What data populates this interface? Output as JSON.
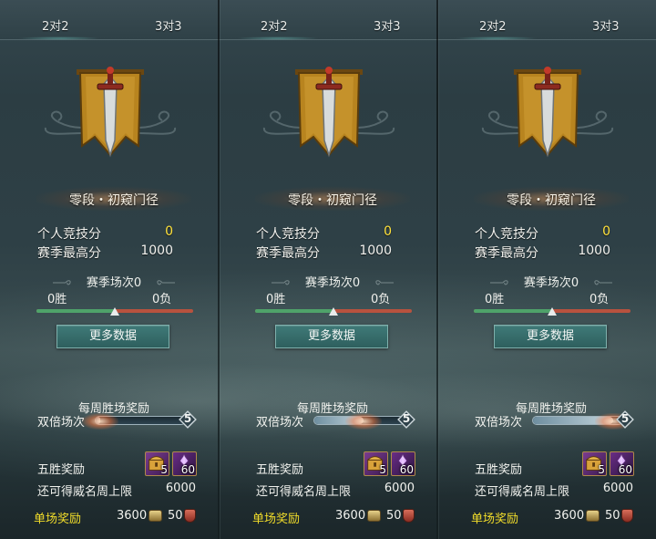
{
  "panels": [
    {
      "tabs": [
        "2对2",
        "3对3"
      ],
      "rank_name": "零段・初窥门径",
      "stats": [
        {
          "label": "个人竞技分",
          "value": "0"
        },
        {
          "label": "赛季最高分",
          "value": "1000"
        }
      ],
      "season_title": "赛季场次0",
      "wins": "0胜",
      "losses": "0负",
      "win_fraction": 0.5,
      "more_button": "更多数据",
      "weekly_title": "每周胜场奖励",
      "double_label": "双倍场次",
      "double_count": "5",
      "double_fraction": 0.05,
      "five_win_label": "五胜奖励",
      "reward_items": [
        {
          "icon": "treasure-chest-icon",
          "qty": "5"
        },
        {
          "icon": "purple-crystal-icon",
          "qty": "60"
        }
      ],
      "limit_label": "还可得威名周上限",
      "limit_value": "6000",
      "single_label": "单场奖励",
      "single_value_1": "3600",
      "single_value_2": "50"
    },
    {
      "tabs": [
        "2对2",
        "3对3"
      ],
      "rank_name": "零段・初窥门径",
      "stats": [
        {
          "label": "个人竞技分",
          "value": "0"
        },
        {
          "label": "赛季最高分",
          "value": "1000"
        }
      ],
      "season_title": "赛季场次0",
      "wins": "0胜",
      "losses": "0负",
      "win_fraction": 0.5,
      "more_button": "更多数据",
      "weekly_title": "每周胜场奖励",
      "double_label": "双倍场次",
      "double_count": "5",
      "double_fraction": 0.55,
      "five_win_label": "五胜奖励",
      "reward_items": [
        {
          "icon": "treasure-chest-icon",
          "qty": "5"
        },
        {
          "icon": "purple-crystal-icon",
          "qty": "60"
        }
      ],
      "limit_label": "还可得威名周上限",
      "limit_value": "6000",
      "single_label": "单场奖励",
      "single_value_1": "3600",
      "single_value_2": "50"
    },
    {
      "tabs": [
        "2对2",
        "3对3"
      ],
      "rank_name": "零段・初窥门径",
      "stats": [
        {
          "label": "个人竞技分",
          "value": "0"
        },
        {
          "label": "赛季最高分",
          "value": "1000"
        }
      ],
      "season_title": "赛季场次0",
      "wins": "0胜",
      "losses": "0负",
      "win_fraction": 0.5,
      "more_button": "更多数据",
      "weekly_title": "每周胜场奖励",
      "double_label": "双倍场次",
      "double_count": "5",
      "double_fraction": 0.9,
      "five_win_label": "五胜奖励",
      "reward_items": [
        {
          "icon": "treasure-chest-icon",
          "qty": "5"
        },
        {
          "icon": "purple-crystal-icon",
          "qty": "60"
        }
      ],
      "limit_label": "还可得威名周上限",
      "limit_value": "6000",
      "single_label": "单场奖励",
      "single_value_1": "3600",
      "single_value_2": "50"
    }
  ],
  "colors": {
    "highlight_yellow": "#ffe23c",
    "gold_label": "#f2dd2a",
    "win_green": "#4fa36a",
    "loss_red": "#b8523e",
    "button_teal": "#2e5f5e",
    "emblem_gold": "#b8841f"
  }
}
